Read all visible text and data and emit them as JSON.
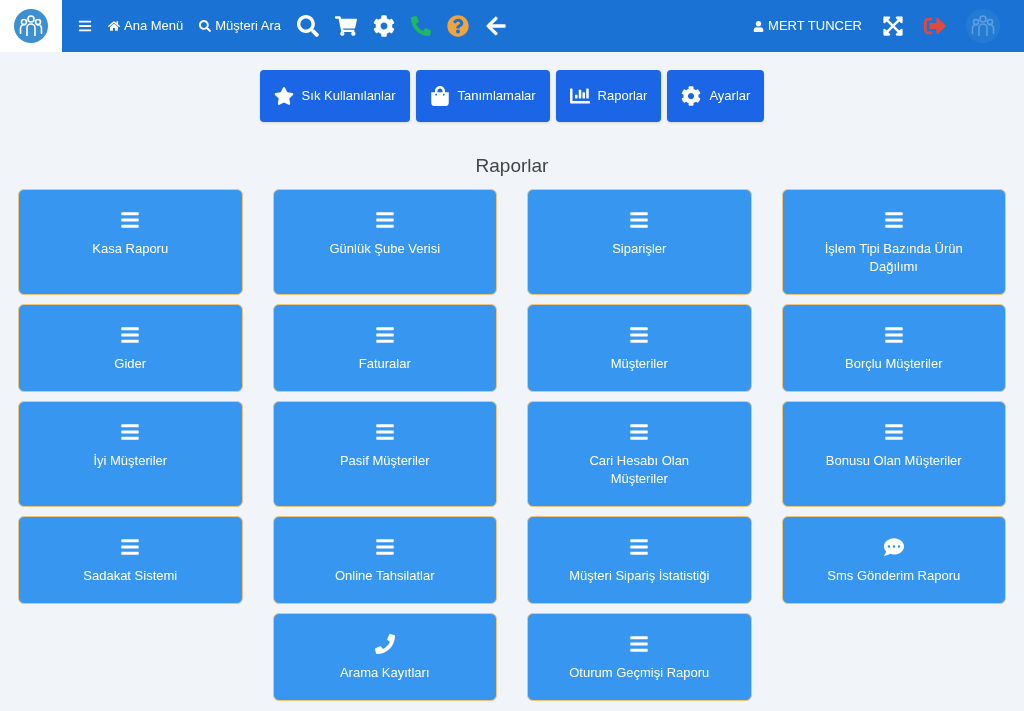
{
  "header": {
    "nav": [
      {
        "kind": "home",
        "label": "Ana Menü"
      },
      {
        "kind": "search",
        "label": "Müşteri Ara"
      }
    ],
    "user": "MERT TUNCER"
  },
  "tabs": [
    {
      "kind": "star",
      "label": "Sık Kullanılanlar",
      "selected": false
    },
    {
      "kind": "bag",
      "label": "Tanımlamalar",
      "selected": false
    },
    {
      "kind": "chart",
      "label": "Raporlar",
      "selected": false
    },
    {
      "kind": "gear",
      "label": "Ayarlar",
      "selected": false
    }
  ],
  "section_title": "Raporlar",
  "report_columns": [
    [
      {
        "kind": "list",
        "label": "Kasa Raporu"
      },
      {
        "kind": "list",
        "label": "Gider"
      },
      {
        "kind": "list",
        "label": "İyi Müşteriler"
      },
      {
        "kind": "list",
        "label": "Sadakat Sistemi"
      }
    ],
    [
      {
        "kind": "list",
        "label": "Günlük Şube Verisi"
      },
      {
        "kind": "list",
        "label": "Faturalar"
      },
      {
        "kind": "list",
        "label": "Pasif Müşteriler"
      },
      {
        "kind": "list",
        "label": "Online Tahsilatlar"
      },
      {
        "kind": "phone",
        "label": "Arama Kayıtları"
      }
    ],
    [
      {
        "kind": "list",
        "label": "Siparişler"
      },
      {
        "kind": "list",
        "label": "Müşteriler"
      },
      {
        "kind": "list",
        "label": "Cari Hesabı Olan Müşteriler"
      },
      {
        "kind": "list",
        "label": "Müşteri Sipariş İstatistiği"
      },
      {
        "kind": "list",
        "label": "Oturum Geçmişi Raporu"
      }
    ],
    [
      {
        "kind": "list",
        "label": "İşlem Tipi Bazında Ürün Dağılımı"
      },
      {
        "kind": "list",
        "label": "Borçlu Müşteriler"
      },
      {
        "kind": "list",
        "label": "Bonusu Olan Müşteriler"
      },
      {
        "kind": "chat",
        "label": "Sms Gönderim Raporu"
      }
    ]
  ]
}
